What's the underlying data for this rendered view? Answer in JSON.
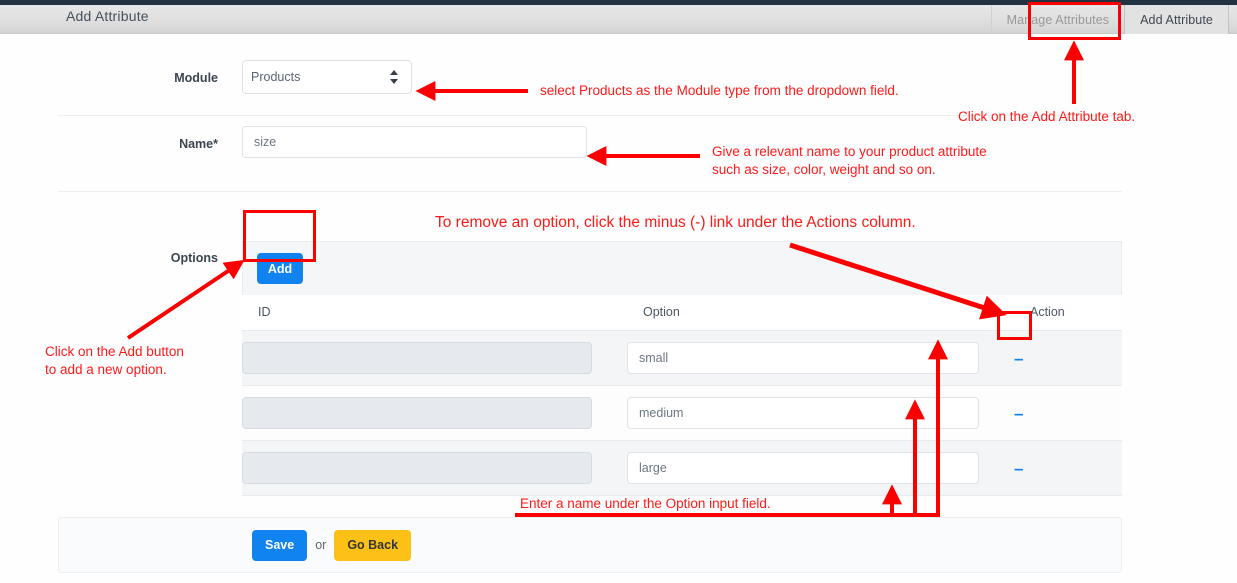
{
  "header": {
    "title": "Add Attribute",
    "tabs": [
      {
        "label": "Manage Attributes",
        "active": false
      },
      {
        "label": "Add Attribute",
        "active": true
      }
    ]
  },
  "form": {
    "module": {
      "label": "Module",
      "value": "Products",
      "options": [
        "Products"
      ]
    },
    "name": {
      "label": "Name*",
      "value": "size",
      "placeholder": ""
    },
    "options": {
      "label": "Options",
      "add_label": "Add"
    }
  },
  "table": {
    "columns": [
      "ID",
      "Option",
      "Action"
    ],
    "rows": [
      {
        "id": "",
        "option": "small",
        "action": "–"
      },
      {
        "id": "",
        "option": "medium",
        "action": "–"
      },
      {
        "id": "",
        "option": "large",
        "action": "–"
      }
    ]
  },
  "footer": {
    "save_label": "Save",
    "or_label": "or",
    "goback_label": "Go Back"
  },
  "annotations": {
    "module": "select Products as the Module type from the dropdown field.",
    "add_tab": "Click on the Add Attribute tab.",
    "name": "Give a relevant name to your product attribute\nsuch as size, color, weight and so on.",
    "remove_option": "To remove an option, click the minus (-) link under the Actions column.",
    "add_button": "Click on the Add button\nto add a new option.",
    "option_input": "Enter a name under the Option input field."
  },
  "colors": {
    "accent": "#1083f0",
    "warning": "#fcc016",
    "annotation": "#ff1a1a",
    "highlight_box": "#fb0000",
    "topbar": "#223243"
  }
}
